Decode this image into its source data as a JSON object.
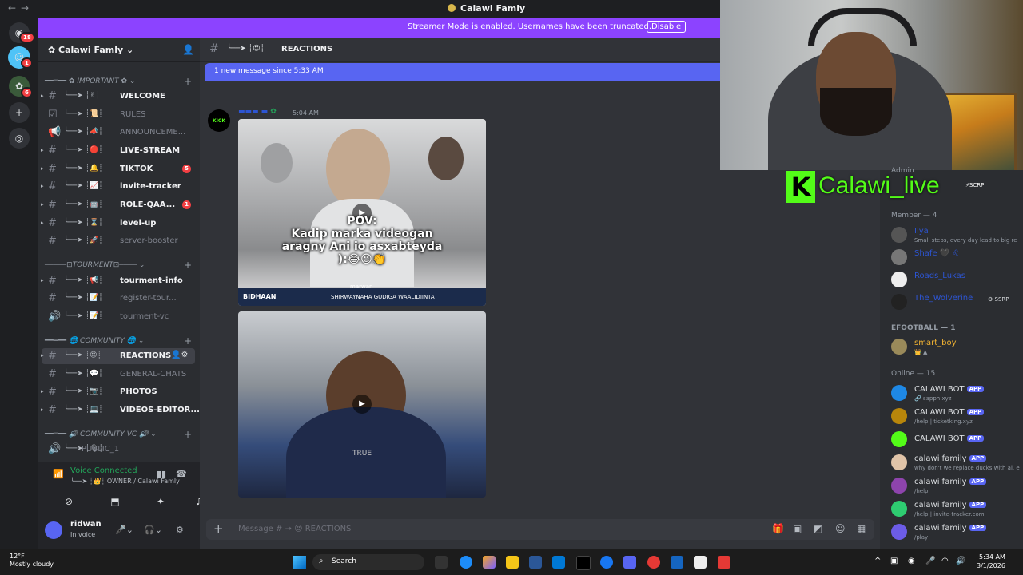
{
  "window": {
    "title": "Calawi Famly"
  },
  "banner": {
    "text": "Streamer Mode is enabled. Usernames have been truncated.",
    "button": "Disable"
  },
  "rail": {
    "badges": [
      "18",
      "1",
      "6"
    ]
  },
  "server": {
    "name": "Calawi Famly"
  },
  "categories": {
    "important": "IMPORTANT",
    "tourment": "TOURMENT",
    "community": "COMMUNITY",
    "community_vc": "COMMUNITY VC"
  },
  "channels": [
    {
      "label": "WELCOME",
      "badge": ""
    },
    {
      "label": "RULES",
      "badge": ""
    },
    {
      "label": "ANNOUNCEME...",
      "badge": ""
    },
    {
      "label": "LIVE-STREAM",
      "badge": ""
    },
    {
      "label": "TIKTOK",
      "badge": "5"
    },
    {
      "label": "invite-tracker",
      "badge": ""
    },
    {
      "label": "ROLE-QAA...",
      "badge": "1"
    },
    {
      "label": "level-up",
      "badge": ""
    },
    {
      "label": "server-booster",
      "badge": ""
    },
    {
      "label": "tourment-info",
      "badge": ""
    },
    {
      "label": "register-tour...",
      "badge": ""
    },
    {
      "label": "tourment-vc",
      "badge": ""
    },
    {
      "label": "REACTIONS",
      "badge": ""
    },
    {
      "label": "GENERAL-CHATS",
      "badge": ""
    },
    {
      "label": "PHOTOS",
      "badge": ""
    },
    {
      "label": "VIDEOS-EDITOR...",
      "badge": ""
    },
    {
      "label": "PUBLIC_1",
      "badge": ""
    }
  ],
  "voice": {
    "status": "Voice Connected",
    "channel": "OWNER / Calawi Famly"
  },
  "user": {
    "name": "ridwan",
    "status": "In voice"
  },
  "chat": {
    "channel": "REACTIONS",
    "new_messages": "1 new message since 5:33 AM",
    "message": {
      "time": "5:04 AM",
      "avatar_text": "KICK"
    },
    "video1": {
      "caption_line1": "POV:",
      "caption_line2": "Kadip marka videogan",
      "caption_line3": "aragny Ani io asxabteyda",
      "caption_line4": "):😂😉👏",
      "small": "marwan",
      "brand": "BIDHAAN",
      "strip": "SHIRWAYNAHA GUDIGA WAALIDIINTA"
    },
    "video2": {
      "caption": "TRUE"
    },
    "input_placeholder": "Message # ➝ 😍 REACTIONS"
  },
  "overlay": {
    "kick_letter": "K",
    "kick_text": "Calawi_live",
    "tag": "SCRP"
  },
  "members": {
    "admin_header": "Admin",
    "member_header": "Member — 4",
    "efootball_header": "EFOOTBALL — 1",
    "online_header": "Online — 15",
    "member_rows": [
      {
        "name": "Ilya",
        "sub": "Small steps, every day lead to big re",
        "tag": ""
      },
      {
        "name": "Shafe",
        "sub": "",
        "tag": ""
      },
      {
        "name": "Roads_Lukas",
        "sub": "",
        "tag": ""
      },
      {
        "name": "The_Wolverine",
        "sub": "",
        "tag": "SSRP"
      }
    ],
    "efootball_rows": [
      {
        "name": "smart_boy",
        "sub": ""
      }
    ],
    "online_rows": [
      {
        "name": "CALAWI BOT",
        "app": "APP",
        "sub": "sapph.xyz",
        "color": "#1e88e5"
      },
      {
        "name": "CALAWI BOT",
        "app": "APP",
        "sub": "/help | ticketking.xyz",
        "color": "#b8860b"
      },
      {
        "name": "CALAWI BOT",
        "app": "APP",
        "sub": "",
        "color": "#53fc18"
      },
      {
        "name": "calawi family",
        "app": "APP",
        "sub": "why don't we replace ducks with ai, e",
        "color": "#e0c4a8"
      },
      {
        "name": "calawi family",
        "app": "APP",
        "sub": "/help",
        "color": "#8e44ad"
      },
      {
        "name": "calawi family",
        "app": "APP",
        "sub": "/help | invite-tracker.com",
        "color": "#2ecc71"
      },
      {
        "name": "calawi family",
        "app": "APP",
        "sub": "/play",
        "color": "#6c5ce7"
      }
    ]
  },
  "taskbar": {
    "temp": "12°F",
    "weather": "Mostly cloudy",
    "search": "Search",
    "time": "5:34 AM",
    "date": "3/1/2026"
  }
}
